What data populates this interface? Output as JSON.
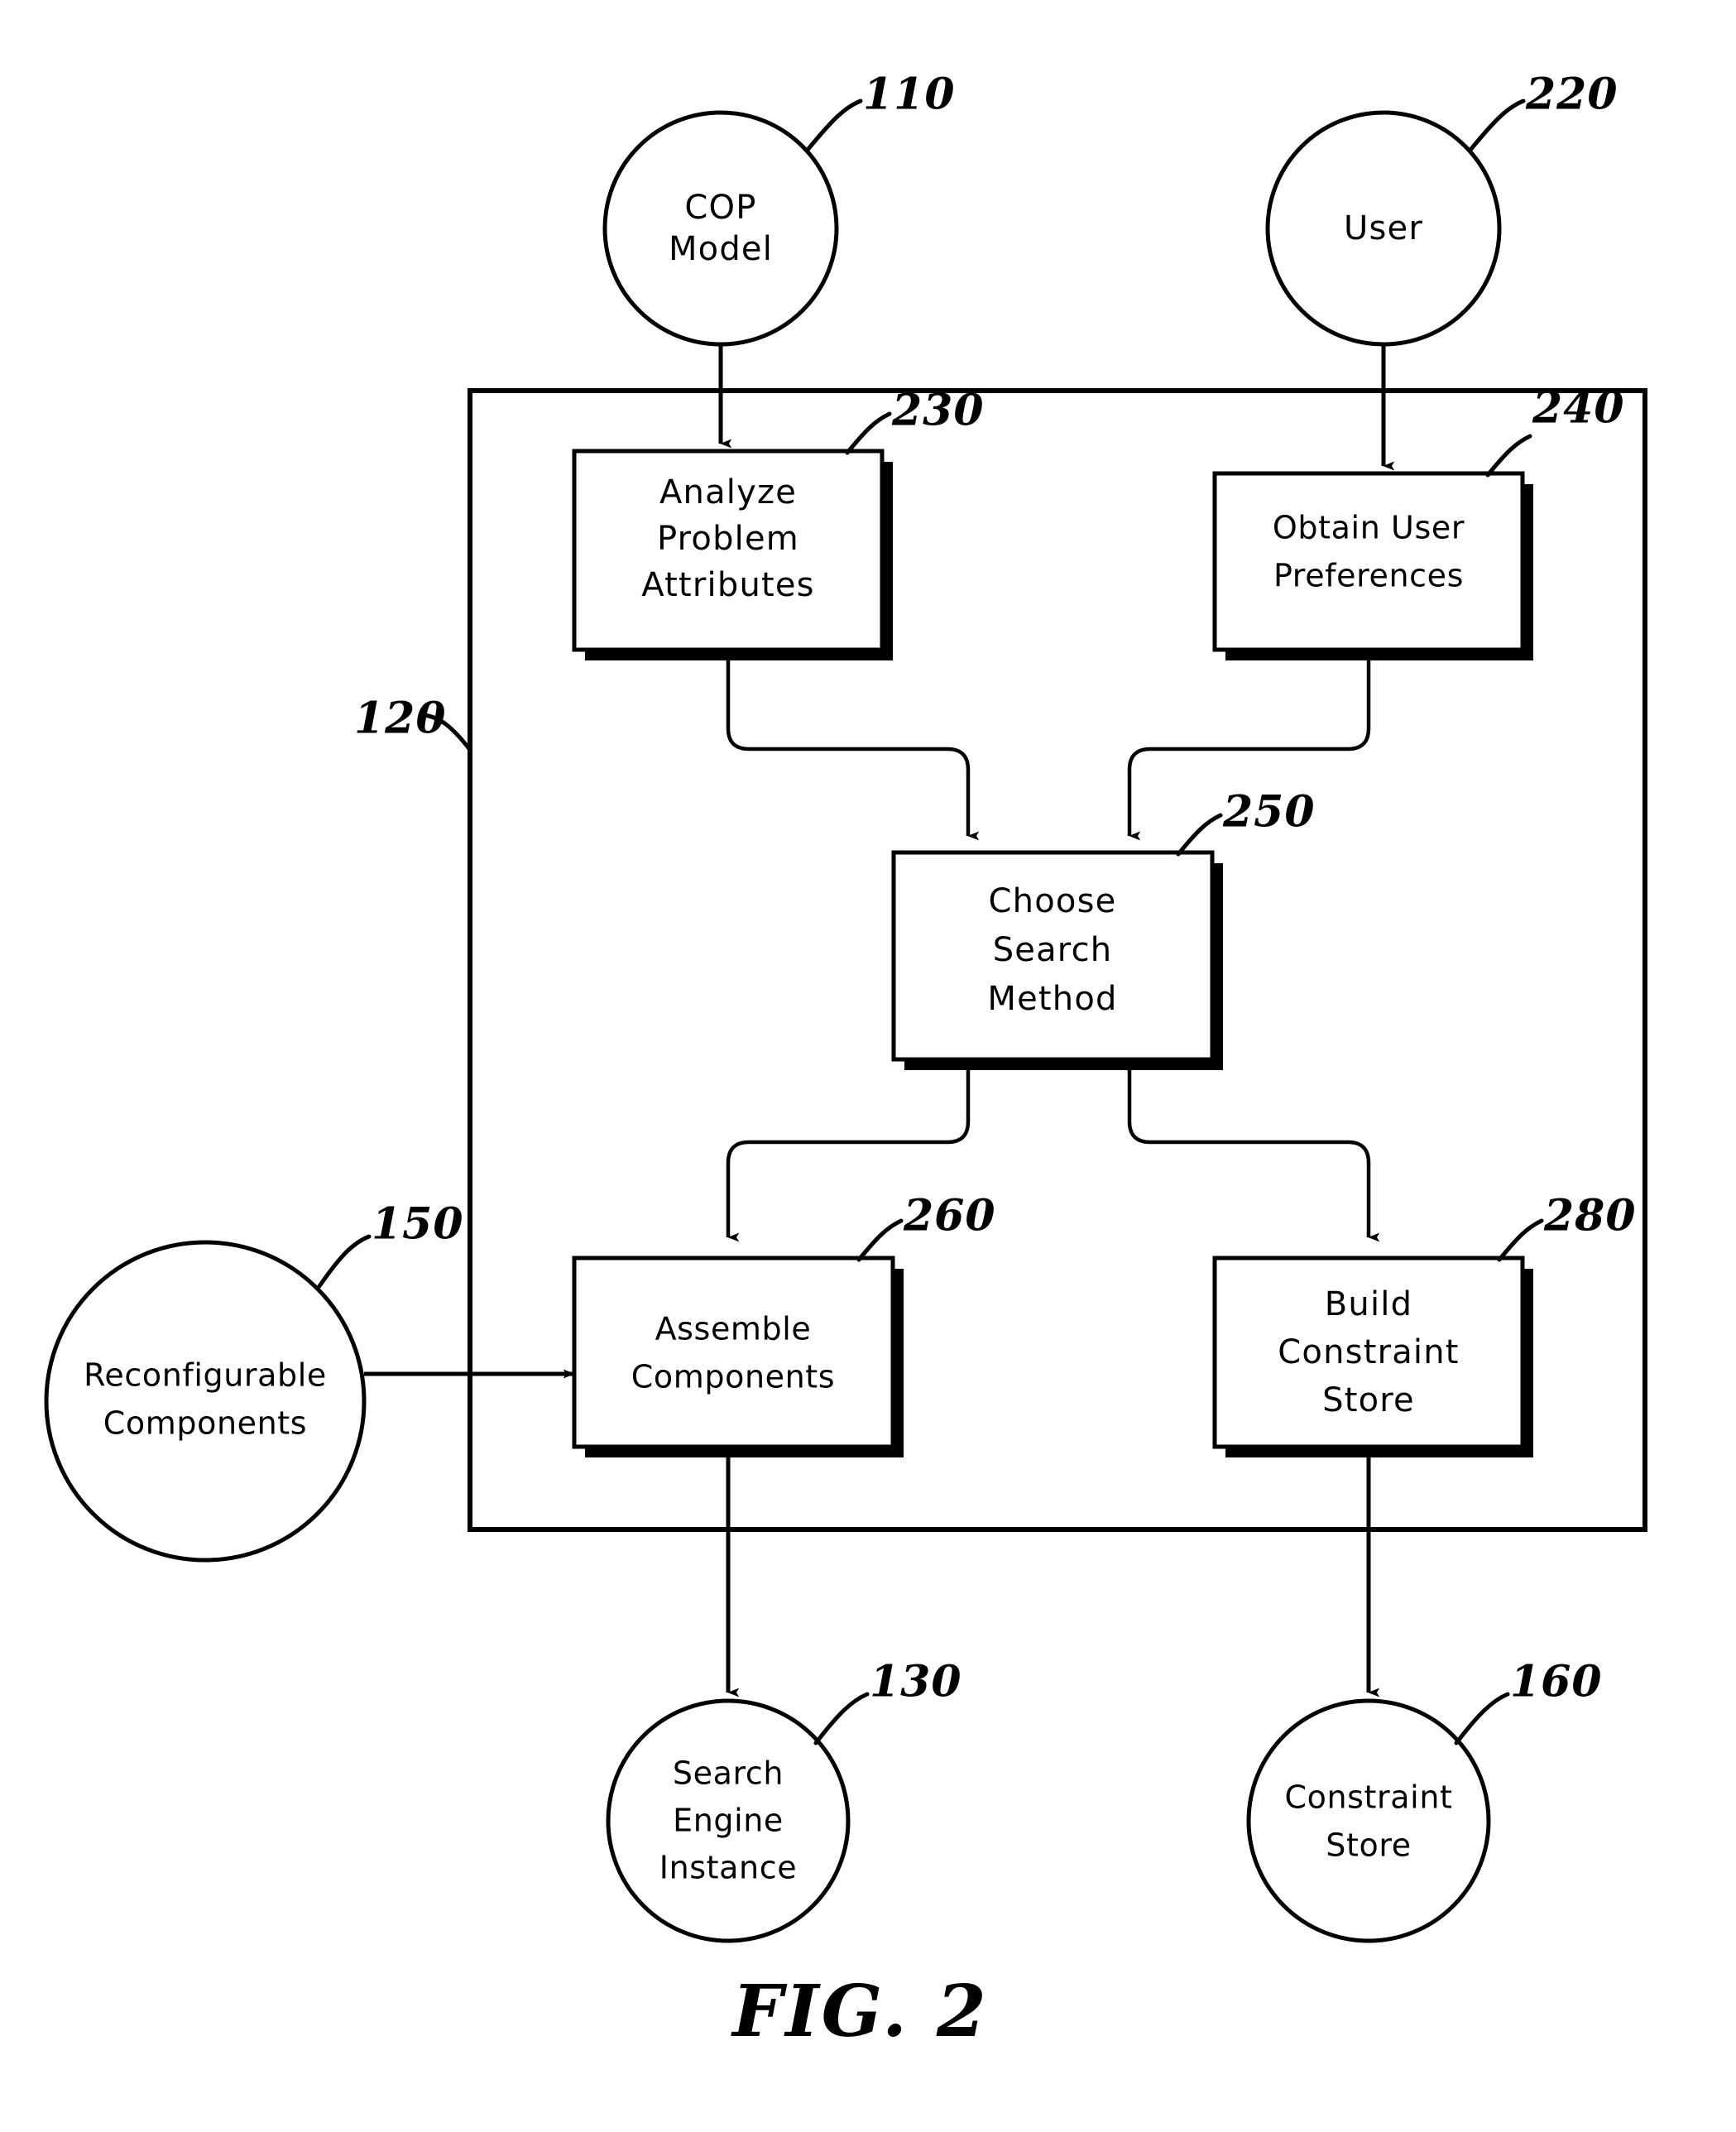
{
  "figure": {
    "caption": "FIG. 2",
    "container_ref": "120"
  },
  "nodes": {
    "cop_model": {
      "label_line1": "COP",
      "label_line2": "Model",
      "ref": "110",
      "shape": "circle"
    },
    "user": {
      "label_line1": "User",
      "label_line2": "",
      "ref": "220",
      "shape": "circle"
    },
    "analyze_problem_attributes": {
      "label_line1": "Analyze",
      "label_line2": "Problem",
      "label_line3": "Attributes",
      "ref": "230",
      "shape": "box"
    },
    "obtain_user_preferences": {
      "label_line1": "Obtain  User",
      "label_line2": "Preferences",
      "ref": "240",
      "shape": "box"
    },
    "choose_search_method": {
      "label_line1": "Choose",
      "label_line2": "Search",
      "label_line3": "Method",
      "ref": "250",
      "shape": "box"
    },
    "reconfigurable_components": {
      "label_line1": "Reconfigurable",
      "label_line2": "Components",
      "ref": "150",
      "shape": "circle"
    },
    "assemble_components": {
      "label_line1": "Assemble",
      "label_line2": "Components",
      "ref": "260",
      "shape": "box"
    },
    "build_constraint_store": {
      "label_line1": "Build",
      "label_line2": "Constraint",
      "label_line3": "Store",
      "ref": "280",
      "shape": "box"
    },
    "search_engine_instance": {
      "label_line1": "Search",
      "label_line2": "Engine",
      "label_line3": "Instance",
      "ref": "130",
      "shape": "circle"
    },
    "constraint_store": {
      "label_line1": "Constraint",
      "label_line2": "Store",
      "ref": "160",
      "shape": "circle"
    }
  },
  "colors": {
    "ink": "#000000",
    "paper": "#ffffff"
  }
}
